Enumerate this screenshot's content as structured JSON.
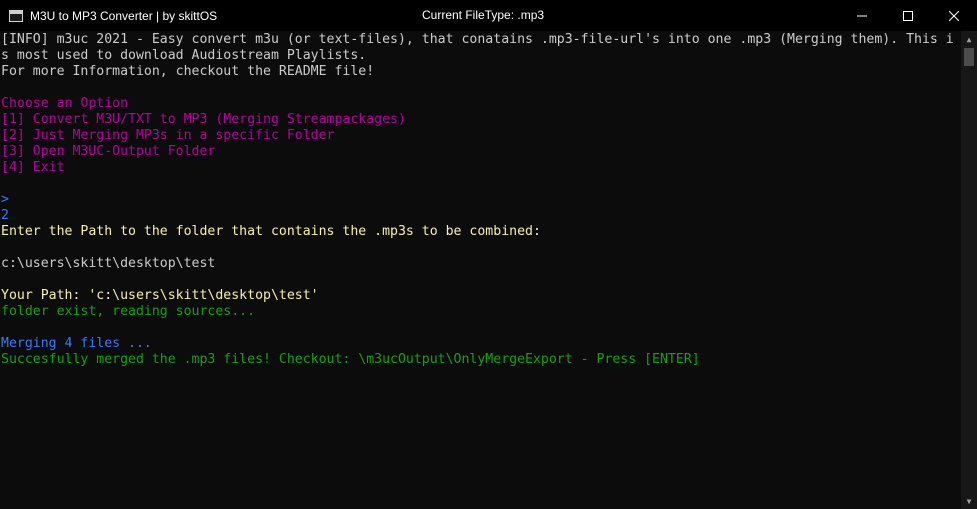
{
  "window": {
    "title": "M3U to MP3 Converter | by skittOS",
    "status": "Current FileType: .mp3"
  },
  "colors": {
    "white": "#cccccc",
    "magenta": "#b4009e",
    "yellow": "#f9f1a5",
    "green": "#13a10e",
    "blue": "#3b78ff"
  },
  "console": {
    "lines": [
      {
        "text": "[INFO] m3uc 2021 - Easy convert m3u (or text-files), that conatains .mp3-file-url's into one .mp3 (Merging them). This i",
        "color": "#cccccc"
      },
      {
        "text": "s most used to download Audiostream Playlists.",
        "color": "#cccccc"
      },
      {
        "text": "For more Information, checkout the README file!",
        "color": "#cccccc"
      },
      {
        "text": "",
        "color": "#cccccc"
      },
      {
        "text": "Choose an Option",
        "color": "#b4009e"
      },
      {
        "text": "[1] Convert M3U/TXT to MP3 (Merging Streampackages)",
        "color": "#b4009e"
      },
      {
        "text": "[2] Just Merging MP3s in a specific Folder",
        "color": "#b4009e"
      },
      {
        "text": "[3] Open M3UC-Output Folder",
        "color": "#b4009e"
      },
      {
        "text": "[4] Exit",
        "color": "#b4009e"
      },
      {
        "text": "",
        "color": "#cccccc"
      },
      {
        "text": ">",
        "color": "#3b78ff"
      },
      {
        "text": "2",
        "color": "#3b78ff"
      },
      {
        "text": "Enter the Path to the folder that contains the .mp3s to be combined:",
        "color": "#f9f1a5"
      },
      {
        "text": "",
        "color": "#cccccc"
      },
      {
        "text": "c:\\users\\skitt\\desktop\\test",
        "color": "#cccccc"
      },
      {
        "text": "",
        "color": "#cccccc"
      },
      {
        "text": "Your Path: 'c:\\users\\skitt\\desktop\\test'",
        "color": "#f9f1a5"
      },
      {
        "text": "folder exist, reading sources...",
        "color": "#13a10e"
      },
      {
        "text": "",
        "color": "#cccccc"
      },
      {
        "text": "Merging 4 files ...",
        "color": "#3b78ff"
      },
      {
        "text": "Succesfully merged the .mp3 files! Checkout: \\m3ucOutput\\OnlyMergeExport - Press [ENTER]",
        "color": "#13a10e"
      }
    ]
  }
}
